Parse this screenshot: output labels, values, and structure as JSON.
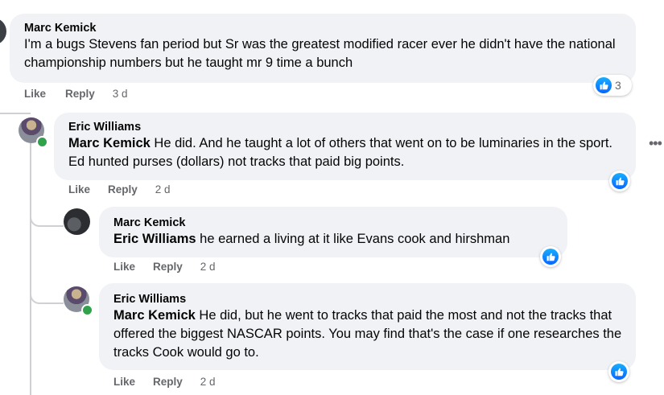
{
  "labels": {
    "like": "Like",
    "reply": "Reply"
  },
  "comments": [
    {
      "author": "Marc Kemick",
      "mention": "",
      "text": "I'm a bugs Stevens fan period but Sr was the greatest modified racer ever he didn't have the national championship numbers but he taught mr 9 time a bunch",
      "time": "3 d",
      "reaction_count": "3"
    },
    {
      "author": "Eric Williams",
      "mention": "Marc Kemick",
      "text": " He did. And he taught a lot of others that went on to be luminaries in the sport. Ed hunted purses (dollars) not tracks that paid big points.",
      "time": "2 d"
    },
    {
      "author": "Marc Kemick",
      "mention": "Eric Williams",
      "text": " he earned a living at it like Evans cook and hirshman",
      "time": "2 d"
    },
    {
      "author": "Eric Williams",
      "mention": "Marc Kemick",
      "text": " He did, but he went to tracks that paid the most and not the tracks that offered the biggest NASCAR points. You may find that's the case if one researches the tracks Cook would go to.",
      "time": "2 d"
    }
  ],
  "more_icon": "more-horizontal-icon",
  "colors": {
    "bubble": "#f0f2f5",
    "like_blue": "#0866ff",
    "online": "#31a24c"
  }
}
